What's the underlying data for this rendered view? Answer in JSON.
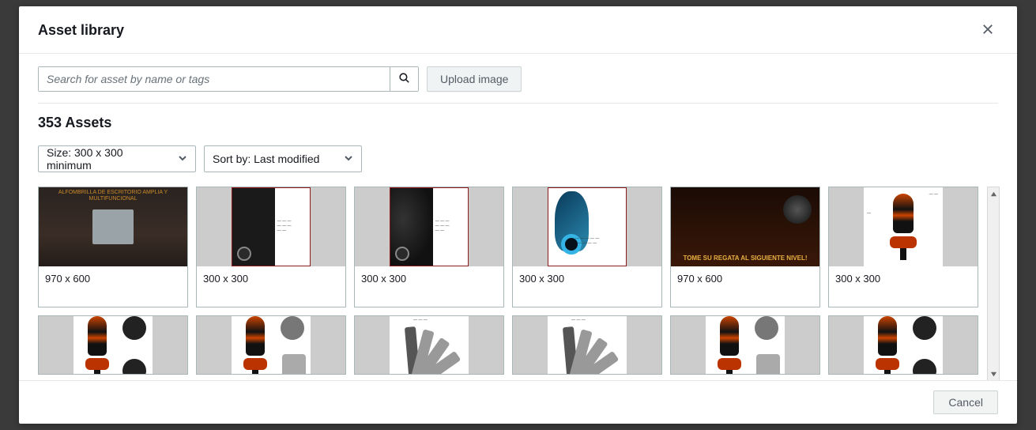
{
  "modal": {
    "title": "Asset library",
    "close_label": "Close"
  },
  "search": {
    "placeholder": "Search for asset by name or tags"
  },
  "upload_label": "Upload image",
  "assets_count": "353 Assets",
  "filters": {
    "size_label": "Size: 300 x 300 minimum",
    "sort_label": "Sort by: Last modified"
  },
  "assets": [
    {
      "size_label": "970 x 600",
      "thumb": "t1",
      "wide": true,
      "caption": "ALFOMBRILLA DE ESCRITORIO AMPLIA Y MULTIFUNCIONAL"
    },
    {
      "size_label": "300 x 300",
      "thumb": "t2",
      "wide": false
    },
    {
      "size_label": "300 x 300",
      "thumb": "t3",
      "wide": false
    },
    {
      "size_label": "300 x 300",
      "thumb": "t4",
      "wide": false
    },
    {
      "size_label": "970 x 600",
      "thumb": "t5",
      "wide": true,
      "caption": "TOME SU REGATA AL SIGUIENTE NIVEL!"
    },
    {
      "size_label": "300 x 300",
      "thumb": "t6",
      "wide": false
    },
    {
      "size_label": "",
      "thumb": "t7",
      "wide": false,
      "short": true
    },
    {
      "size_label": "",
      "thumb": "t7b",
      "wide": false,
      "short": true
    },
    {
      "size_label": "",
      "thumb": "t8",
      "wide": false,
      "short": true
    },
    {
      "size_label": "",
      "thumb": "t8",
      "wide": false,
      "short": true
    },
    {
      "size_label": "",
      "thumb": "t7b",
      "wide": false,
      "short": true
    },
    {
      "size_label": "",
      "thumb": "t7",
      "wide": false,
      "short": true
    }
  ],
  "footer": {
    "cancel_label": "Cancel"
  }
}
